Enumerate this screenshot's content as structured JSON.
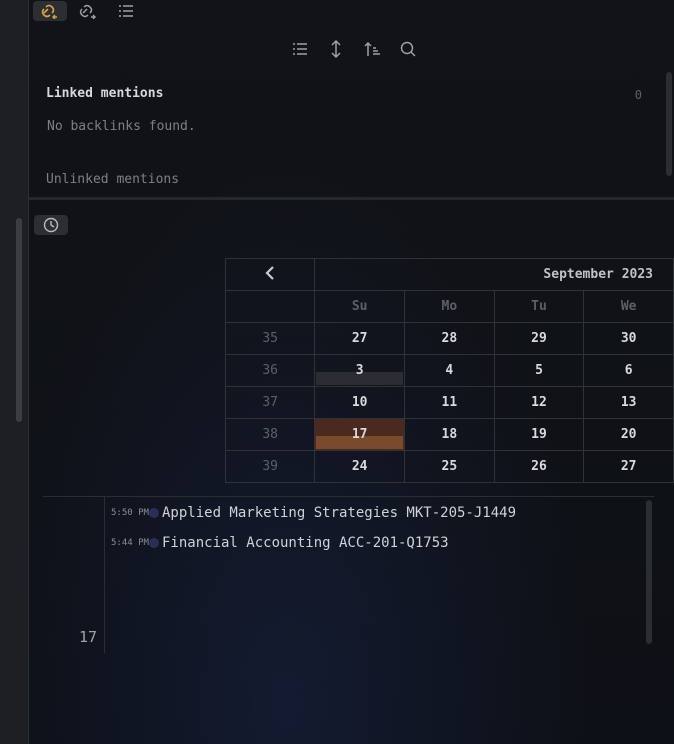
{
  "backlinks": {
    "linked_heading": "Linked mentions",
    "linked_count": "0",
    "empty_message": "No backlinks found.",
    "unlinked_heading": "Unlinked mentions"
  },
  "calendar": {
    "month_label": "September 2023",
    "prev_symbol": "<",
    "weekdays": [
      "Su",
      "Mo",
      "Tu",
      "We"
    ],
    "weeks": [
      {
        "num": "35",
        "days": [
          "27",
          "28",
          "29",
          "30"
        ]
      },
      {
        "num": "36",
        "days": [
          "3",
          "4",
          "5",
          "6"
        ]
      },
      {
        "num": "37",
        "days": [
          "10",
          "11",
          "12",
          "13"
        ]
      },
      {
        "num": "38",
        "days": [
          "17",
          "18",
          "19",
          "20"
        ]
      },
      {
        "num": "39",
        "days": [
          "24",
          "25",
          "26",
          "27"
        ]
      }
    ],
    "today": "17"
  },
  "day_notes": {
    "day": "17",
    "items": [
      {
        "time": "5:50 PM",
        "title": "Applied Marketing Strategies MKT-205-J1449"
      },
      {
        "time": "5:44 PM",
        "title": "Financial Accounting ACC-201-Q1753"
      }
    ]
  },
  "colors": {
    "accent": "#d9a441",
    "today_bg": "#4a2a1e",
    "dot": "#2a2f5a"
  }
}
